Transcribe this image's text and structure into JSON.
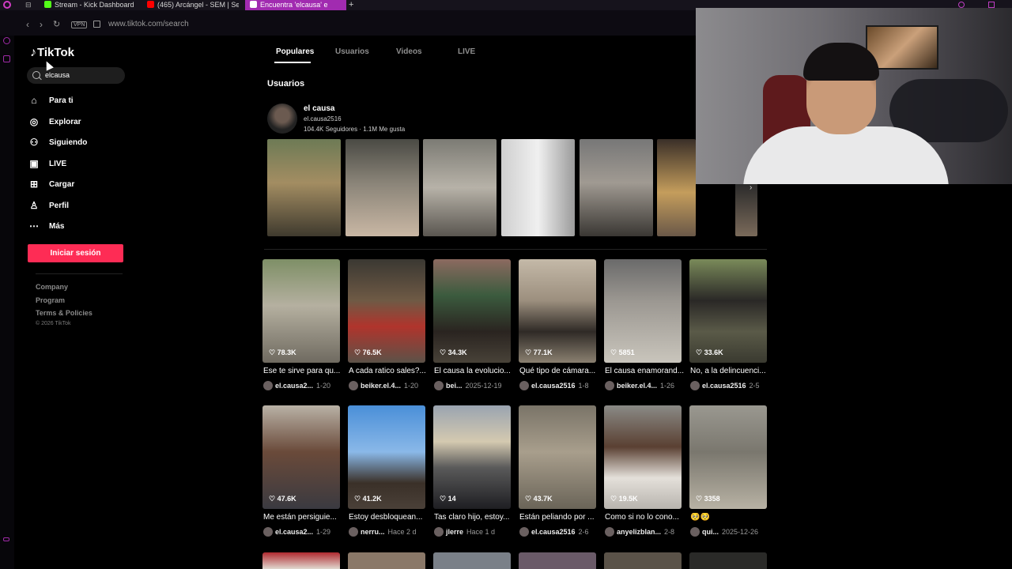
{
  "browser": {
    "tabs": [
      {
        "label": "Stream - Kick Dashboard",
        "icon": "kick-icon",
        "color": "#53fc18"
      },
      {
        "label": "(465) Arcángel - SEM | Se",
        "icon": "youtube-icon",
        "color": "#ff0000"
      },
      {
        "label": "Encuentra 'elcausa' e",
        "icon": "tiktok-icon",
        "color": "#ffffff"
      }
    ],
    "active_tab": 2,
    "vpn_label": "VPN",
    "url": "www.tiktok.com/search"
  },
  "tiktok": {
    "logo": "TikTok",
    "search_value": "elcausa",
    "nav": [
      {
        "label": "Para ti",
        "icon": "home-icon"
      },
      {
        "label": "Explorar",
        "icon": "compass-icon"
      },
      {
        "label": "Siguiendo",
        "icon": "following-icon"
      },
      {
        "label": "LIVE",
        "icon": "live-icon"
      },
      {
        "label": "Cargar",
        "icon": "upload-icon"
      },
      {
        "label": "Perfil",
        "icon": "profile-icon"
      },
      {
        "label": "Más",
        "icon": "more-icon"
      }
    ],
    "login_button": "Iniciar sesión",
    "footer": [
      "Company",
      "Program",
      "Terms & Policies"
    ],
    "copyright": "© 2026 TikTok",
    "accent": "#fe2c55"
  },
  "results": {
    "tabs": [
      "Populares",
      "Usuarios",
      "Videos",
      "LIVE"
    ],
    "active_tab": "Populares",
    "users_title": "Usuarios",
    "user": {
      "name": "el causa",
      "handle": "el.causa2516",
      "followers": "104.4K",
      "followers_label": "Seguidores",
      "likes": "1.1M",
      "likes_label": "Me gusta"
    },
    "videos": [
      {
        "likes": "78.3K",
        "caption": "Ese te sirve para qu...",
        "author": "el.causa2...",
        "date": "1-20"
      },
      {
        "likes": "76.5K",
        "caption": "A cada ratico sales?...",
        "author": "beiker.el.4...",
        "date": "1-20"
      },
      {
        "likes": "34.3K",
        "caption": "El causa la evolucio...",
        "author": "bei...",
        "date": "2025-12-19"
      },
      {
        "likes": "77.1K",
        "caption": "Qué tipo de cámara...",
        "author": "el.causa2516",
        "date": "1-8"
      },
      {
        "likes": "5851",
        "caption": "El causa enamorand...",
        "author": "beiker.el.4...",
        "date": "1-26"
      },
      {
        "likes": "33.6K",
        "caption": "No, a la delincuenci...",
        "author": "el.causa2516",
        "date": "2-5"
      },
      {
        "likes": "47.6K",
        "caption": "Me están persiguie...",
        "author": "el.causa2...",
        "date": "1-29"
      },
      {
        "likes": "41.2K",
        "caption": "Estoy desbloquean...",
        "author": "nerru...",
        "date": "Hace 2 d"
      },
      {
        "likes": "14",
        "caption": "Tas claro hijo, estoy...",
        "author": "jlerre",
        "date": "Hace 1 d"
      },
      {
        "likes": "43.7K",
        "caption": "Están peliando por ...",
        "author": "el.causa2516",
        "date": "2-6"
      },
      {
        "likes": "19.5K",
        "caption": "Como si no lo cono...",
        "author": "anyelizblan...",
        "date": "2-8"
      },
      {
        "likes": "3358",
        "caption": "🥺🥺",
        "author": "qui...",
        "date": "2025-12-26"
      }
    ]
  }
}
